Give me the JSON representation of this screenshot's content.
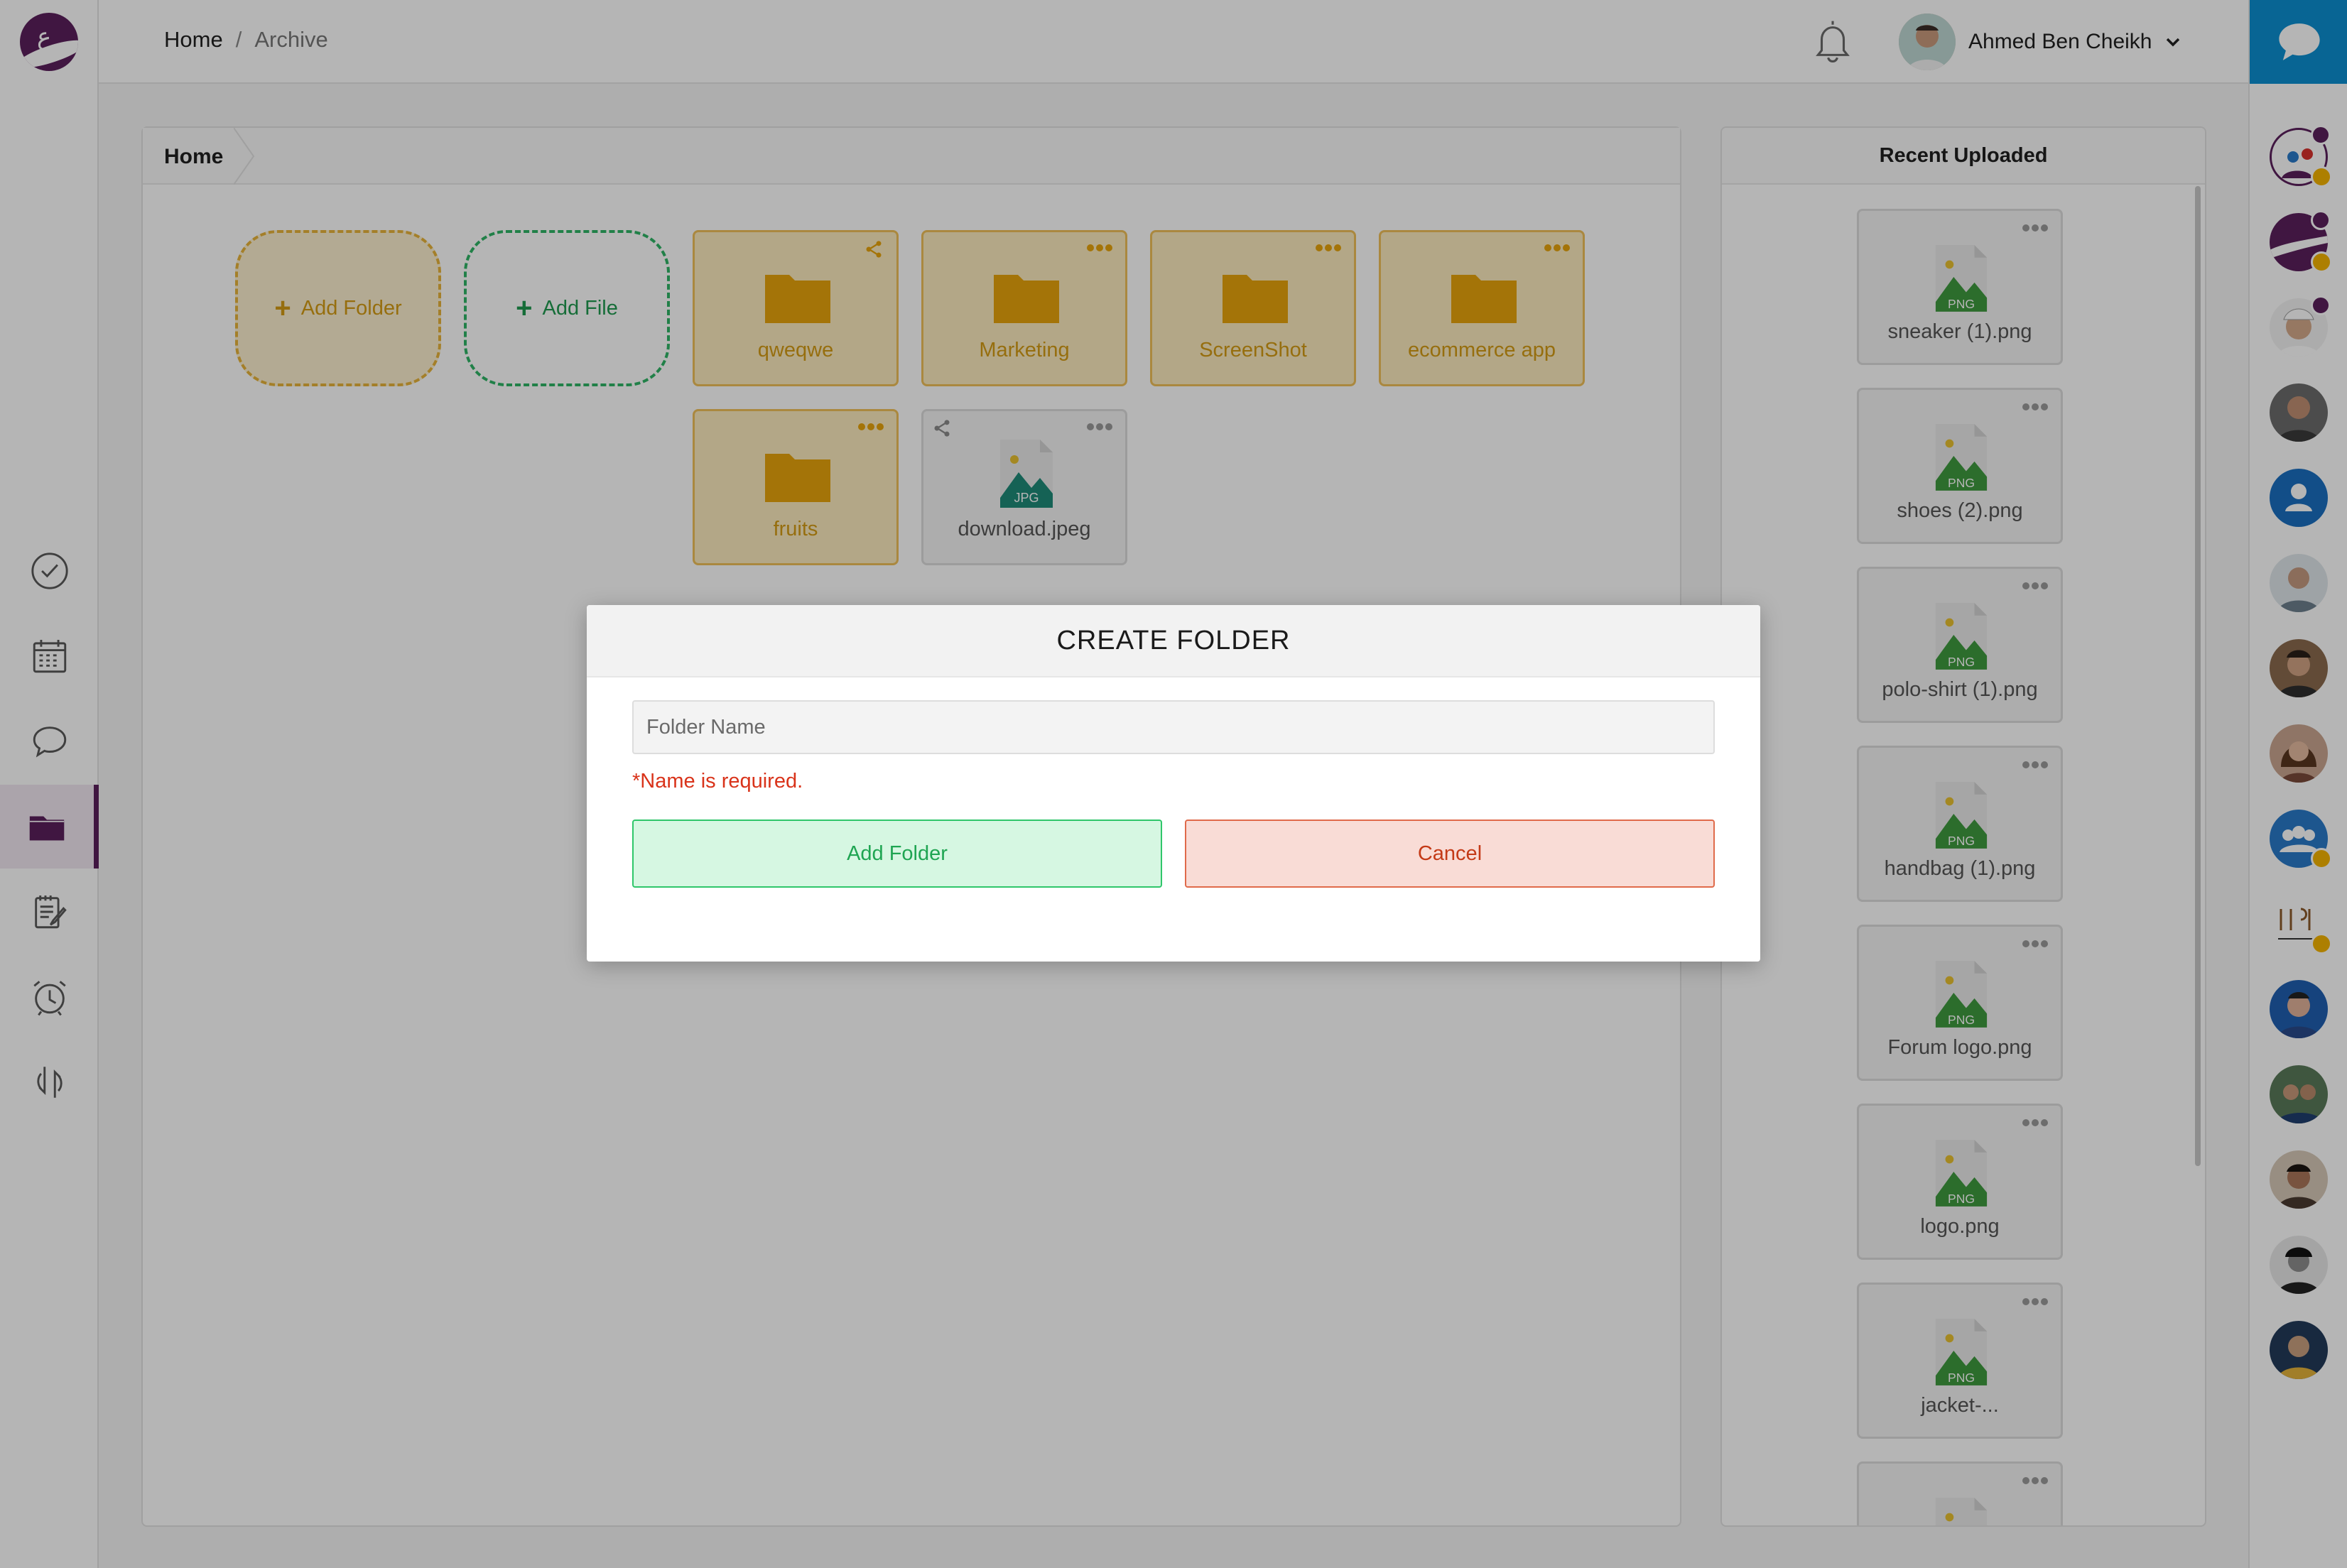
{
  "header": {
    "breadcrumb": {
      "home": "Home",
      "separator": "/",
      "current": "Archive"
    },
    "user": {
      "name": "Ahmed Ben Cheikh"
    }
  },
  "files": {
    "panel_crumb": "Home",
    "add_folder_label": "Add Folder",
    "add_file_label": "Add File",
    "items": [
      {
        "type": "folder",
        "name": "qweqwe",
        "shared": true
      },
      {
        "type": "folder",
        "name": "Marketing"
      },
      {
        "type": "folder",
        "name": "ScreenShot"
      },
      {
        "type": "folder",
        "name": "ecommerce app"
      },
      {
        "type": "folder",
        "name": "fruits"
      },
      {
        "type": "file",
        "name": "download.jpeg",
        "ext": "JPG",
        "shared": true
      }
    ]
  },
  "recent": {
    "title": "Recent Uploaded",
    "items": [
      {
        "name": "sneaker (1).png",
        "ext": "PNG"
      },
      {
        "name": "shoes (2).png",
        "ext": "PNG"
      },
      {
        "name": "polo-shirt (1).png",
        "ext": "PNG"
      },
      {
        "name": "handbag (1).png",
        "ext": "PNG"
      },
      {
        "name": "Forum logo.png",
        "ext": "PNG"
      },
      {
        "name": "logo.png",
        "ext": "PNG"
      },
      {
        "name": "jacket-...",
        "ext": "PNG"
      },
      {
        "name": "",
        "ext": "PNG"
      }
    ]
  },
  "modal": {
    "title": "CREATE FOLDER",
    "input_placeholder": "Folder Name",
    "input_value": "",
    "error": "*Name is required.",
    "submit_label": "Add Folder",
    "cancel_label": "Cancel"
  },
  "colors": {
    "brand": "#5b1f5c",
    "chat_accent": "#0c8fd1",
    "folder": "#e8a40c",
    "success": "#2fc66a",
    "danger": "#e06a4a",
    "png_green": "#3f9a3f",
    "jpg_teal": "#1e8a78"
  },
  "icons": {
    "left_nav": [
      "check-circle-icon",
      "calendar-icon",
      "chat-bubble-icon",
      "folder-icon",
      "notepad-icon",
      "alarm-clock-icon",
      "sync-icon"
    ],
    "header": [
      "bell-icon",
      "chevron-down-icon"
    ]
  }
}
